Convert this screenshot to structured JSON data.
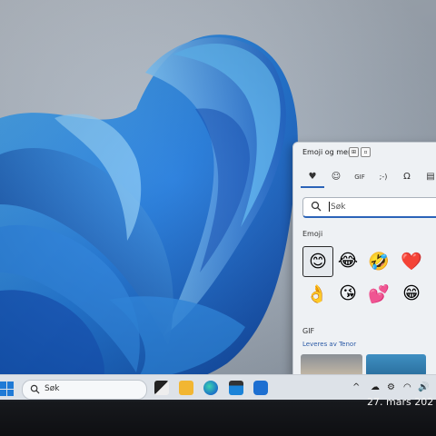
{
  "emoji_panel": {
    "title": "Emoji og mer",
    "tabs": [
      {
        "name": "tab-recent",
        "glyph": "♥"
      },
      {
        "name": "tab-emoji",
        "glyph": "☺"
      },
      {
        "name": "tab-gif",
        "glyph": "GIF"
      },
      {
        "name": "tab-kaomoji",
        "glyph": ";-)"
      },
      {
        "name": "tab-symbols",
        "glyph": "Ω"
      },
      {
        "name": "tab-clipboard",
        "glyph": "▤"
      }
    ],
    "search_placeholder": "Søk",
    "emoji_section_label": "Emoji",
    "emojis": [
      "😊",
      "😂",
      "🤣",
      "❤️",
      "👌",
      "😘",
      "💕",
      "😁"
    ],
    "gif_section_label": "GIF",
    "gif_provider": "Leveres av Tenor"
  },
  "taskbar": {
    "search_label": "Søk"
  },
  "clock": {
    "date": "27. mars 202"
  },
  "colors": {
    "accent": "#2b63b8",
    "wallpaper_blue": "#1f7ad6"
  }
}
